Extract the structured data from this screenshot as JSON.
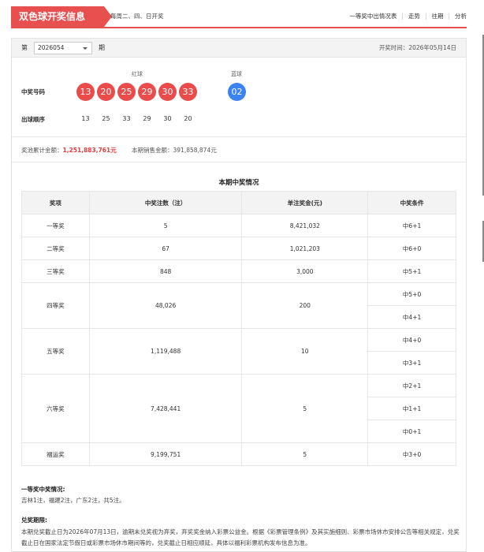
{
  "header": {
    "title": "双色球开奖信息",
    "schedule": "每周二、四、日开奖",
    "nav": [
      "一等奖中出情况表",
      "走势",
      "往期",
      "分析"
    ]
  },
  "draw": {
    "di": "第",
    "issue": "2026054",
    "qi": "期",
    "date_label": "开奖时间：",
    "date": "2026年05月14日"
  },
  "numbers": {
    "red_label": "红球",
    "blue_label": "蓝球",
    "win_label": "中奖号码",
    "red": [
      "13",
      "20",
      "25",
      "29",
      "30",
      "33"
    ],
    "blue": "02",
    "order_label": "出球顺序",
    "order": [
      "13",
      "25",
      "33",
      "29",
      "30",
      "20"
    ]
  },
  "pool": {
    "pool_label": "奖池累计金额：",
    "pool_value": "1,251,883,761元",
    "sales_label": "本期销售金额：",
    "sales_value": "391,858,874元"
  },
  "table": {
    "title": "本期中奖情况",
    "headers": [
      "奖项",
      "中奖注数（注）",
      "单注奖金(元)",
      "中奖条件"
    ],
    "rows": [
      {
        "name": "一等奖",
        "count": "5",
        "prize": "8,421,032",
        "conds": [
          "中6+1"
        ]
      },
      {
        "name": "二等奖",
        "count": "67",
        "prize": "1,021,203",
        "conds": [
          "中6+0"
        ]
      },
      {
        "name": "三等奖",
        "count": "848",
        "prize": "3,000",
        "conds": [
          "中5+1"
        ]
      },
      {
        "name": "四等奖",
        "count": "48,026",
        "prize": "200",
        "conds": [
          "中5+0",
          "中4+1"
        ]
      },
      {
        "name": "五等奖",
        "count": "1,119,488",
        "prize": "10",
        "conds": [
          "中4+0",
          "中3+1"
        ]
      },
      {
        "name": "六等奖",
        "count": "7,428,441",
        "prize": "5",
        "conds": [
          "中2+1",
          "中1+1",
          "中0+1"
        ]
      },
      {
        "name": "福运奖",
        "count": "9,199,751",
        "prize": "5",
        "conds": [
          "中3+0"
        ]
      }
    ]
  },
  "winners": {
    "title": "一等奖中奖情况:",
    "text": "吉林1注，福建2注，广东2注，共5注。"
  },
  "expiry": {
    "title": "兑奖期限:",
    "text": "本期兑奖截止日为2026年07月13日，逾期未兑奖视为弃奖，弃奖奖金纳入彩票公益金。根据《彩票管理条例》及其实施细则、彩票市场休市安排公告等相关规定，兑奖截止日在国家法定节假日或彩票市场休市期间等的，兑奖截止日相应顺延，具体以福利彩票机构发布信息为准。"
  }
}
